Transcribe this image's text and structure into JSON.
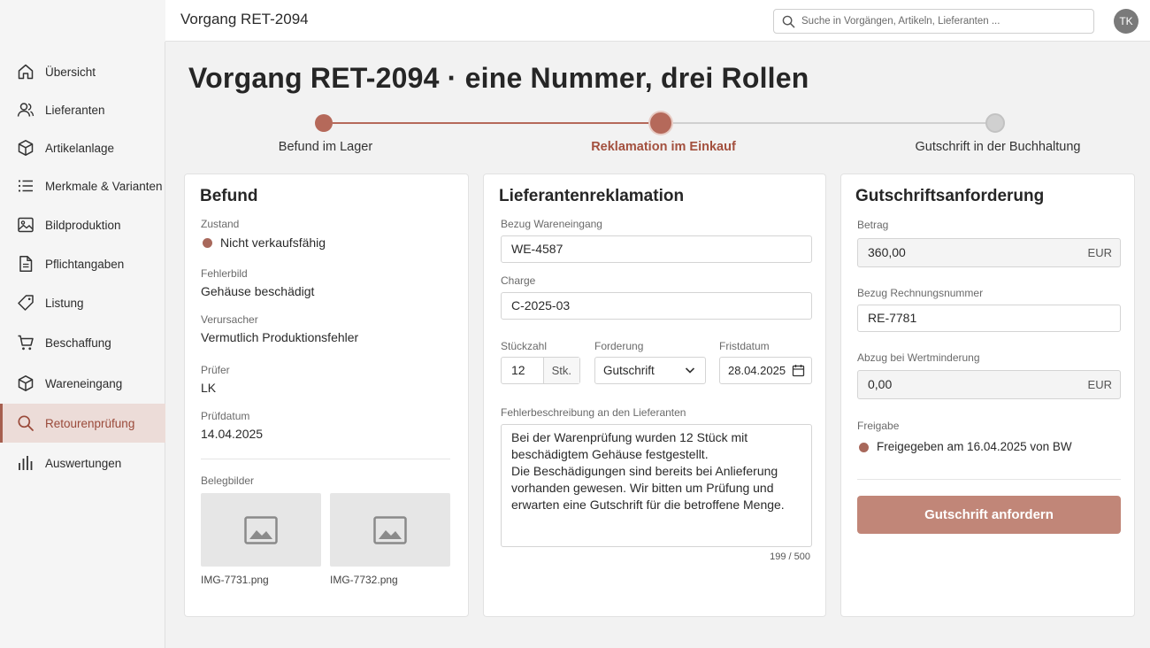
{
  "header": {
    "app_title": "Vorgang RET-2094",
    "search_placeholder": "Suche in Vorgängen, Artikeln, Lieferanten ...",
    "avatar_initials": "TK"
  },
  "sidebar": {
    "items": [
      {
        "label": "Übersicht",
        "icon": "home-icon"
      },
      {
        "label": "Lieferanten",
        "icon": "users-icon"
      },
      {
        "label": "Artikelanlage",
        "icon": "box-icon"
      },
      {
        "label": "Merkmale & Varianten",
        "icon": "list-icon"
      },
      {
        "label": "Bildproduktion",
        "icon": "image-icon"
      },
      {
        "label": "Pflichtangaben",
        "icon": "document-icon"
      },
      {
        "label": "Listung",
        "icon": "tag-icon"
      },
      {
        "label": "Beschaffung",
        "icon": "cart-icon"
      },
      {
        "label": "Wareneingang",
        "icon": "box-icon"
      },
      {
        "label": "Retourenprüfung",
        "icon": "search-icon",
        "active": true
      },
      {
        "label": "Auswertungen",
        "icon": "bar-chart-icon"
      }
    ]
  },
  "page": {
    "title": "Vorgang RET-2094 · eine Nummer, drei Rollen"
  },
  "stepper": {
    "steps": [
      {
        "label": "Befund im Lager",
        "state": "done"
      },
      {
        "label": "Reklamation im Einkauf",
        "state": "current"
      },
      {
        "label": "Gutschrift in der Buchhaltung",
        "state": "pending"
      }
    ],
    "colors": {
      "done": "#b5695a",
      "current": "#b5695a",
      "pending": "#d0d0d0",
      "current_label": "#a3503e"
    }
  },
  "befund": {
    "title": "Befund",
    "zustand_label": "Zustand",
    "zustand_value": "Nicht verkaufsfähig",
    "fehlerbild_label": "Fehlerbild",
    "fehlerbild_value": "Gehäuse beschädigt",
    "verursacher_label": "Verursacher",
    "verursacher_value": "Vermutlich Produktionsfehler",
    "pruefer_label": "Prüfer",
    "pruefer_value": "LK",
    "pruefdatum_label": "Prüfdatum",
    "pruefdatum_value": "14.04.2025",
    "belegbilder_label": "Belegbilder",
    "images": [
      {
        "caption": "IMG-7731.png"
      },
      {
        "caption": "IMG-7732.png"
      }
    ]
  },
  "reklamation": {
    "title": "Lieferantenreklamation",
    "bezug_label": "Bezug Wareneingang",
    "bezug_value": "WE-4587",
    "charge_label": "Charge",
    "charge_value": "C-2025-03",
    "stueckzahl_label": "Stückzahl",
    "stueckzahl_value": "12",
    "stueckzahl_unit": "Stk.",
    "forderung_label": "Forderung",
    "forderung_value": "Gutschrift",
    "fristdatum_label": "Fristdatum",
    "fristdatum_value": "28.04.2025",
    "beschreibung_label": "Fehlerbeschreibung an den Lieferanten",
    "beschreibung_value": "Bei der Warenprüfung wurden 12 Stück mit beschädigtem Gehäuse festgestellt.\nDie Beschädigungen sind bereits bei Anlieferung vorhanden gewesen. Wir bitten um Prüfung und erwarten eine Gutschrift für die betroffene Menge.",
    "counter": "199 / 500"
  },
  "gutschrift": {
    "title": "Gutschriftsanforderung",
    "betrag_label": "Betrag",
    "betrag_value": "360,00",
    "currency": "EUR",
    "rechnung_label": "Bezug Rechnungsnummer",
    "rechnung_value": "RE-7781",
    "abzug_label": "Abzug bei Wertminderung",
    "abzug_value": "0,00",
    "abzug_currency": "EUR",
    "freigabe_label": "Freigabe",
    "freigabe_value": "Freigegeben am 16.04.2025 von BW",
    "button_label": "Gutschrift anfordern"
  }
}
